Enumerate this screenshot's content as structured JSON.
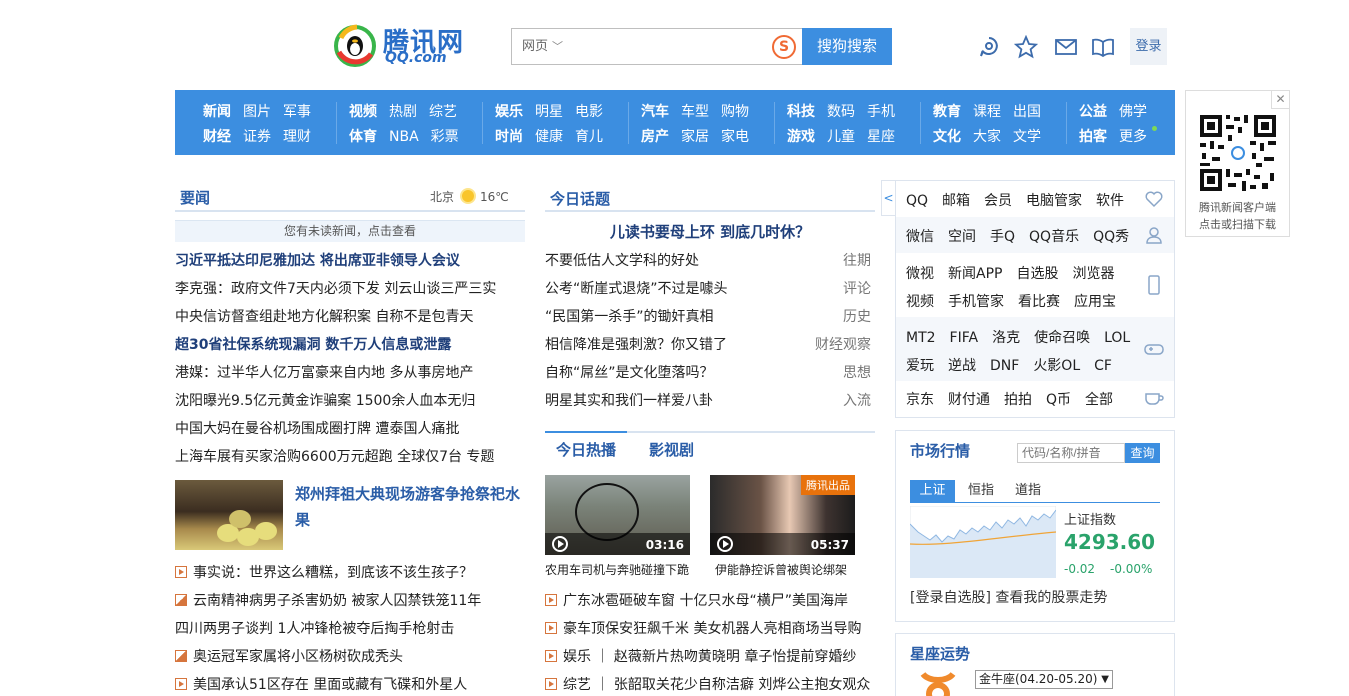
{
  "brand": {
    "name": "腾讯网",
    "domain": "QQ.com"
  },
  "search": {
    "scope": "网页",
    "placeholder": "",
    "button": "搜狗搜索"
  },
  "header": {
    "login": "登录"
  },
  "nav": [
    {
      "row1": [
        "新闻",
        "图片",
        "军事"
      ],
      "row2": [
        "财经",
        "证券",
        "理财"
      ]
    },
    {
      "row1": [
        "视频",
        "热剧",
        "综艺"
      ],
      "row2": [
        "体育",
        "NBA",
        "彩票"
      ]
    },
    {
      "row1": [
        "娱乐",
        "明星",
        "电影"
      ],
      "row2": [
        "时尚",
        "健康",
        "育儿"
      ]
    },
    {
      "row1": [
        "汽车",
        "车型",
        "购物"
      ],
      "row2": [
        "房产",
        "家居",
        "家电"
      ]
    },
    {
      "row1": [
        "科技",
        "数码",
        "手机"
      ],
      "row2": [
        "游戏",
        "儿童",
        "星座"
      ]
    },
    {
      "row1": [
        "教育",
        "课程",
        "出国"
      ],
      "row2": [
        "文化",
        "大家",
        "文学"
      ]
    },
    {
      "row1": [
        "公益",
        "佛学"
      ],
      "row2": [
        "拍客",
        "更多"
      ]
    }
  ],
  "qr": {
    "line1": "腾讯新闻客户端",
    "line2": "点击或扫描下载"
  },
  "yaowen": {
    "title": "要闻",
    "city": "北京",
    "temp": "16℃",
    "unread": "您有未读新闻，点击查看",
    "news": [
      "习近平抵达印尼雅加达 将出席亚非领导人会议",
      "李克强：政府文件7天内必须下发 刘云山谈三严三实",
      "中央信访督查组赴地方化解积案 自称不是包青天",
      "超30省社保系统现漏洞 数千万人信息或泄露",
      "港媒：过半华人亿万富豪来自内地 多从事房地产",
      "沈阳曝光9.5亿元黄金诈骗案 1500余人血本无归",
      "中国大妈在曼谷机场围成圈打牌 遭泰国人痛批",
      "上海车展有买家洽购6600万元超跑 全球仅7台 专题"
    ],
    "feature": "郑州拜祖大典现场游客争抢祭祀水果",
    "more": [
      "事实说：世界这么糟糕，到底该不该生孩子？",
      "云南精神病男子杀害奶奶 被家人囚禁铁笼11年",
      "四川两男子谈判 1人冲锋枪被夺后掏手枪射击",
      "奥运冠军家属将小区杨树砍成秃头",
      "美国承认51区存在 里面或藏有飞碟和外星人"
    ]
  },
  "huati": {
    "title": "今日话题",
    "headline": "儿读书要母上环 到底几时休？",
    "items": [
      {
        "text": "不要低估人文学科的好处",
        "tag": "往期"
      },
      {
        "text": "公考“断崖式退烧”不过是噱头",
        "tag": "评论"
      },
      {
        "text": "“民国第一杀手”的锄奸真相",
        "tag": "历史"
      },
      {
        "text": "相信降准是强刺激？你又错了",
        "tag": "财经观察"
      },
      {
        "text": "自称“屌丝”是文化堕落吗？",
        "tag": "思想"
      },
      {
        "text": "明星其实和我们一样爱八卦",
        "tag": "入流"
      }
    ]
  },
  "tabs": {
    "tab1": "今日热播",
    "tab2": "影视剧"
  },
  "videos": [
    {
      "duration": "03:16",
      "caption": "农用车司机与奔驰碰撞下跪"
    },
    {
      "duration": "05:37",
      "caption": "伊能静控诉曾被舆论绑架",
      "badge": "腾讯出品"
    }
  ],
  "video_news": [
    "广东冰雹砸破车窗 十亿只水母“横尸”美国海岸",
    "豪车顶保安狂飙千米 美女机器人亮相商场当导购",
    "娱乐 ｜ 赵薇新片热吻黄晓明 章子怡提前穿婚纱",
    "综艺 ｜ 张韶取关花少自称洁癖 刘烨公主抱女观众"
  ],
  "services": [
    [
      "QQ",
      "邮箱",
      "会员",
      "电脑管家",
      "软件"
    ],
    [
      "微信",
      "空间",
      "手Q",
      "QQ音乐",
      "QQ秀"
    ],
    [
      "微视",
      "新闻APP",
      "自选股",
      "浏览器"
    ],
    [
      "视频",
      "手机管家",
      "看比赛",
      "应用宝"
    ],
    [
      "MT2",
      "FIFA",
      "洛克",
      "使命召唤",
      "LOL"
    ],
    [
      "爱玩",
      "逆战",
      "DNF",
      "火影OL",
      "CF"
    ],
    [
      "京东",
      "财付通",
      "拍拍",
      "Q币",
      "全部"
    ]
  ],
  "market": {
    "title": "市场行情",
    "placeholder": "代码/名称/拼音",
    "button": "查询",
    "tabs": [
      "上证",
      "恒指",
      "道指"
    ],
    "index_name": "上证指数",
    "index_value": "4293.60",
    "change": "-0.02",
    "change_pct": "-0.00%",
    "footer": "[登录自选股] 查看我的股票走势"
  },
  "xingzuo": {
    "title": "星座运势",
    "selected": "金牛座(04.20-05.20)"
  },
  "colors": {
    "nav_bg": "#3c8ee0",
    "title_blue": "#2a5da7",
    "up_green": "#2aa36b"
  }
}
